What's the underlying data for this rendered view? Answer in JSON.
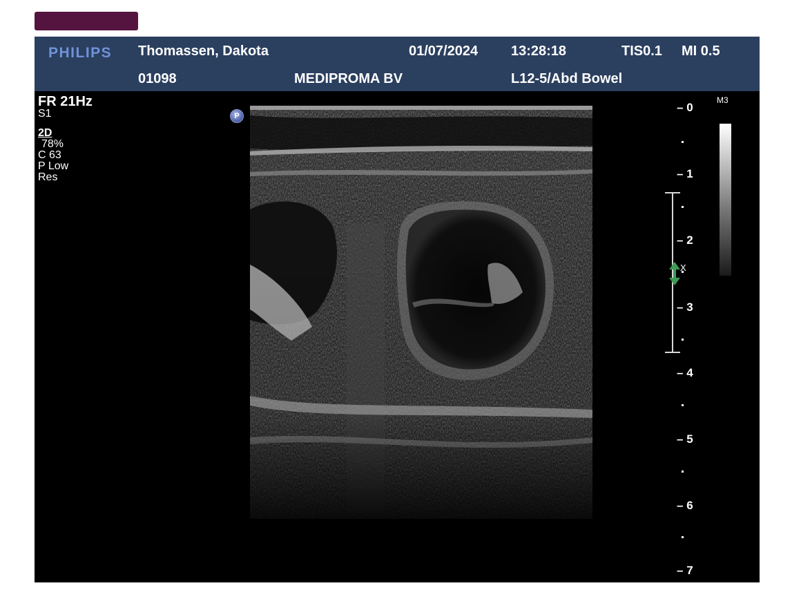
{
  "header": {
    "brand": "PHILIPS",
    "patient_name": "Thomassen, Dakota",
    "date": "01/07/2024",
    "time": "13:28:18",
    "tis": "TIS0.1",
    "mi": "MI 0.5",
    "patient_id": "01098",
    "institution": "MEDIPROMA BV",
    "probe_preset": "L12-5/Abd Bowel"
  },
  "left_panel": {
    "frame_rate": "FR 21Hz",
    "setting": "S1",
    "mode": "2D",
    "gain": "78%",
    "compression": "C 63",
    "power": "P Low",
    "resolution": "Res"
  },
  "marker": {
    "label": "P"
  },
  "depth_scale": {
    "label": "M3",
    "ticks": [
      "0",
      "1",
      "2",
      "3",
      "4",
      "5",
      "6",
      "7"
    ]
  },
  "focus": {
    "label": "X"
  },
  "colors": {
    "header_bg": "#2b3f5f",
    "brand": "#6f93d8",
    "tab_chip": "#55143f",
    "focus_marker": "#3f9a55"
  }
}
